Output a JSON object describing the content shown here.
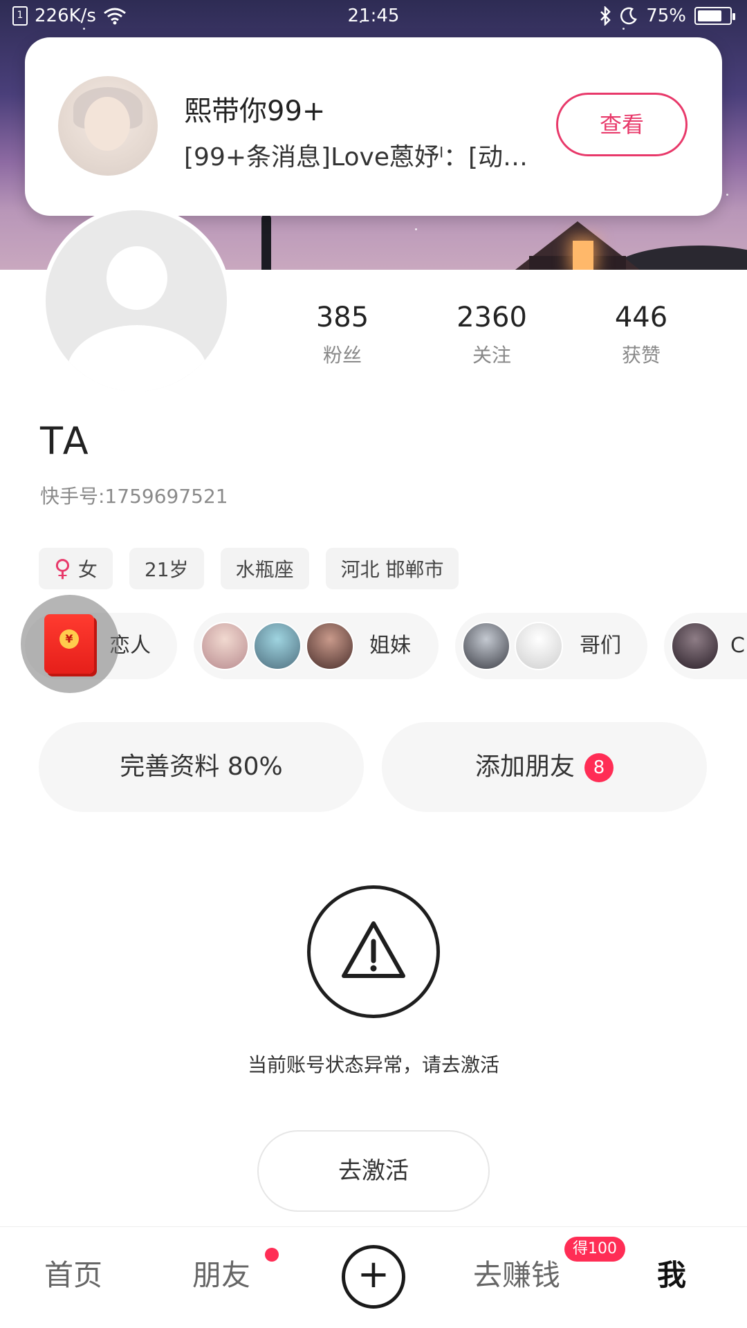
{
  "status_bar": {
    "network_speed": "226K/s",
    "time": "21:45",
    "battery": "75%"
  },
  "notification": {
    "title": "熙带你99+",
    "message": "[99+条消息]Love蒽妤ˡ：[动…",
    "view_label": "查看"
  },
  "stats": [
    {
      "value": "385",
      "label": "粉丝"
    },
    {
      "value": "2360",
      "label": "关注"
    },
    {
      "value": "446",
      "label": "获赞"
    }
  ],
  "profile": {
    "name": "TA",
    "user_id": "快手号:1759697521"
  },
  "tags": {
    "gender": "女",
    "age": "21岁",
    "zodiac": "水瓶座",
    "location": "河北 邯郸市"
  },
  "relations": [
    {
      "label": "恋人"
    },
    {
      "label": "姐妹"
    },
    {
      "label": "哥们"
    },
    {
      "label": "C"
    }
  ],
  "redpacket_symbol": "¥",
  "actions": {
    "complete_profile": "完善资料 80%",
    "add_friend": "添加朋友",
    "add_friend_count": "8"
  },
  "warning": {
    "message": "当前账号状态异常，请去激活",
    "activate_label": "去激活",
    "icon": "warning-triangle-icon"
  },
  "bottom_nav": {
    "home": "首页",
    "friends": "朋友",
    "plus": "+",
    "earn": "去赚钱",
    "earn_badge": "得100",
    "me": "我"
  },
  "colors": {
    "accent": "#e8396a",
    "badge": "#ff2d55"
  }
}
